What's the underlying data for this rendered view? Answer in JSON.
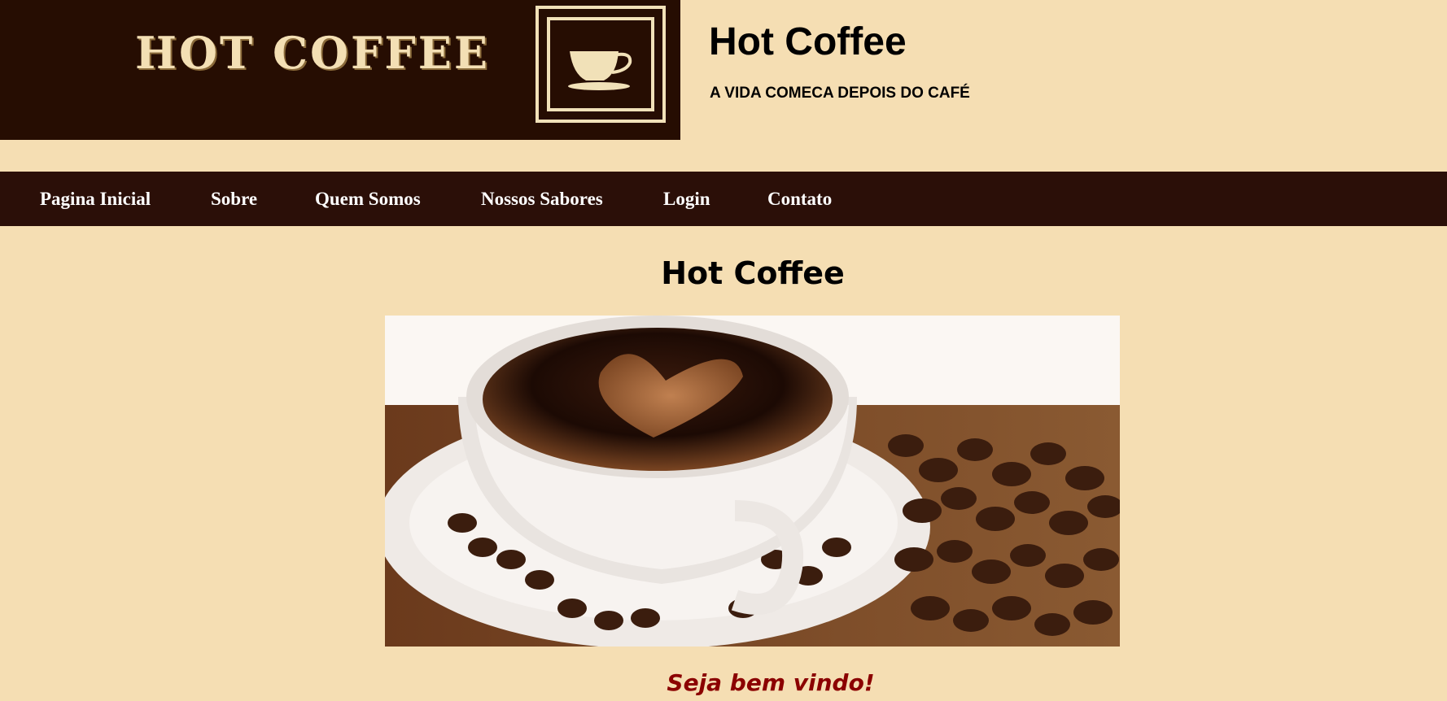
{
  "header": {
    "logo_text": "HOT COFFEE",
    "title": "Hot Coffee",
    "tagline": "A VIDA COMECA DEPOIS DO CAFÉ"
  },
  "nav": {
    "items": [
      {
        "label": "Pagina Inicial"
      },
      {
        "label": "Sobre"
      },
      {
        "label": "Quem Somos"
      },
      {
        "label": "Nossos Sabores"
      },
      {
        "label": "Login"
      },
      {
        "label": "Contato"
      }
    ]
  },
  "main": {
    "title": "Hot Coffee",
    "welcome": "Seja bem vindo!"
  },
  "colors": {
    "page_background": "#f5deb3",
    "nav_background": "#2b0f08",
    "logo_background": "#260d02",
    "welcome_text": "#8b0000"
  },
  "icons": [
    "coffee-cup-icon"
  ]
}
